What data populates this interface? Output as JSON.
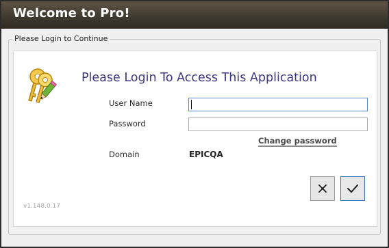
{
  "window": {
    "title": "Welcome to Pro!"
  },
  "group": {
    "legend": "Please Login to Continue"
  },
  "login": {
    "heading": "Please Login To Access This Application",
    "username_label": "User Name",
    "username_value": "",
    "password_label": "Password",
    "password_value": "",
    "change_password_label": "Change password",
    "domain_label": "Domain",
    "domain_value": "EPICQA"
  },
  "buttons": {
    "cancel_icon": "close-icon",
    "ok_icon": "checkmark-icon"
  },
  "footer": {
    "version": "v1.148.0.17"
  },
  "colors": {
    "title_bar": "#403a30",
    "heading": "#3a3680",
    "focus_border": "#5a86c9"
  }
}
